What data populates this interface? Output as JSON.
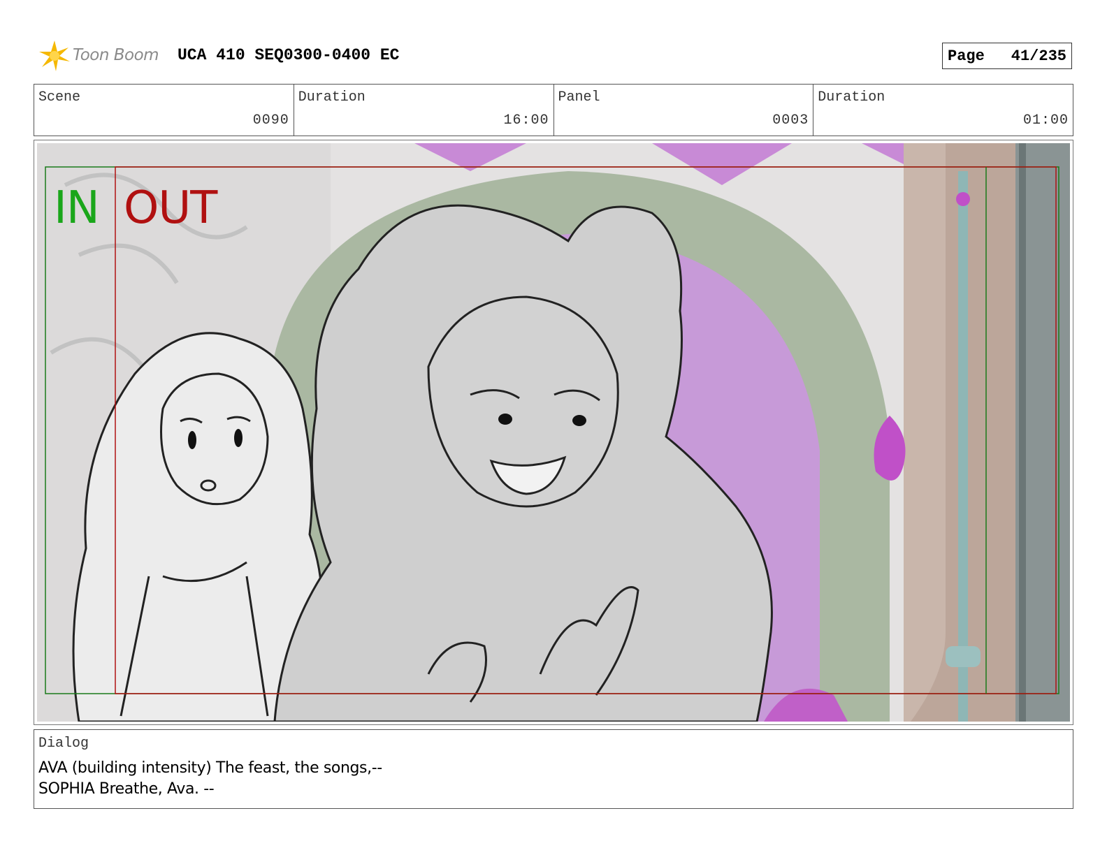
{
  "header": {
    "logo_text": "Toon Boom",
    "title": "UCA 410 SEQ0300-0400 EC",
    "page_label": "Page",
    "page_number": "41/235"
  },
  "info": {
    "scene_label": "Scene",
    "scene_value": "0090",
    "scene_duration_label": "Duration",
    "scene_duration_value": "16:00",
    "panel_label": "Panel",
    "panel_value": "0003",
    "panel_duration_label": "Duration",
    "panel_duration_value": "01:00"
  },
  "panel": {
    "in_label": "IN",
    "out_label": "OUT",
    "in_color": "#1aa61a",
    "out_color": "#b01010"
  },
  "dialog": {
    "label": "Dialog",
    "lines": [
      "AVA (building intensity) The feast, the songs,--",
      "SOPHIA Breathe, Ava. --"
    ]
  },
  "icons": {
    "logo": "toon-boom-starburst-icon"
  }
}
